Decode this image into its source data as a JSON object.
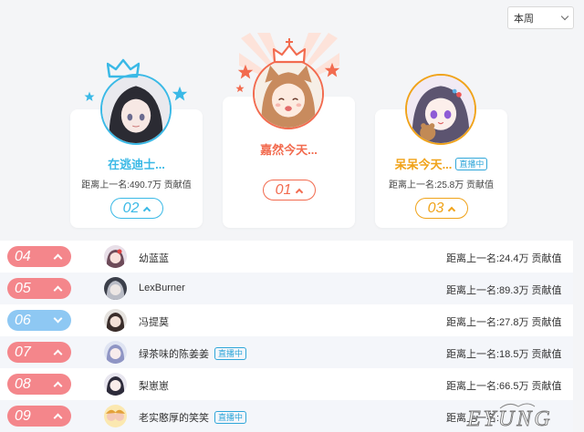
{
  "period_select": {
    "selected": "本周"
  },
  "podium": [
    {
      "rank": "02",
      "name": "在逃迪士...",
      "gap": "距离上一名:490.7万 贡献值",
      "trend": "up",
      "color": "#3ab9e6",
      "live": false,
      "avatar_icon": "anime-avatar-dark-hair"
    },
    {
      "rank": "01",
      "name": "嘉然今天...",
      "gap": "",
      "trend": "up",
      "color": "#f26b4f",
      "live": false,
      "avatar_icon": "anime-avatar-cat-ears"
    },
    {
      "rank": "03",
      "name": "呆呆今天...",
      "gap": "距离上一名:25.8万 贡献值",
      "trend": "up",
      "color": "#f0a31a",
      "live": true,
      "avatar_icon": "anime-avatar-purple-eyes"
    }
  ],
  "live_label": "直播中",
  "rows": [
    {
      "rank": "04",
      "name": "幼蓝蓝",
      "gap": "距离上一名:24.4万 贡献值",
      "trend": "up",
      "live": false
    },
    {
      "rank": "05",
      "name": "LexBurner",
      "gap": "距离上一名:89.3万 贡献值",
      "trend": "up",
      "live": false
    },
    {
      "rank": "06",
      "name": "冯提莫",
      "gap": "距离上一名:27.8万 贡献值",
      "trend": "down",
      "live": false
    },
    {
      "rank": "07",
      "name": "绿茶味的陈姜姜",
      "gap": "距离上一名:18.5万 贡献值",
      "trend": "up",
      "live": true
    },
    {
      "rank": "08",
      "name": "梨崽崽",
      "gap": "距离上一名:66.5万 贡献值",
      "trend": "up",
      "live": false
    },
    {
      "rank": "09",
      "name": "老实憨厚的笑笑",
      "gap": "距离上一名:",
      "trend": "up",
      "live": true
    }
  ],
  "watermark": {
    "text": "EYUNG"
  },
  "colors": {
    "rank_up": "#f4868b",
    "rank_down": "#8ec8f3",
    "live_badge": "#2fa6d9"
  }
}
